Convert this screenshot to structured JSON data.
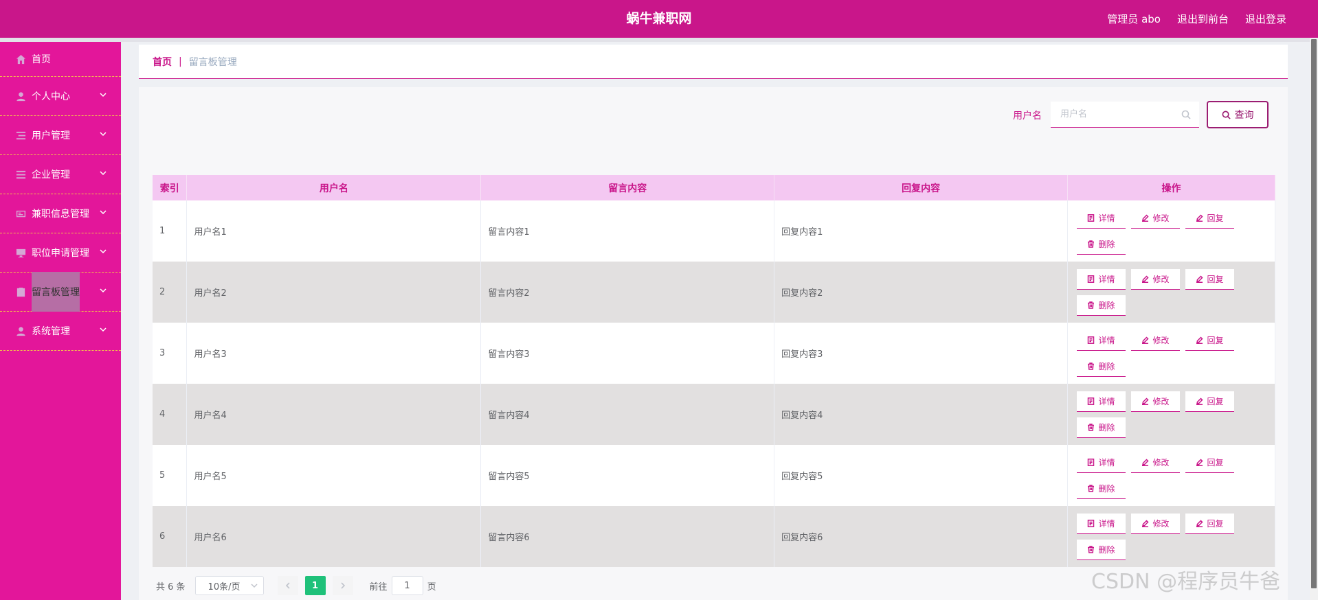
{
  "header": {
    "title": "蜗牛兼职网",
    "admin_label": "管理员 abo",
    "back_to_front": "退出到前台",
    "logout": "退出登录"
  },
  "sidebar": {
    "items": [
      {
        "label": "首页",
        "icon": "home-icon"
      },
      {
        "label": "个人中心",
        "icon": "user-icon"
      },
      {
        "label": "用户管理",
        "icon": "list-icon"
      },
      {
        "label": "企业管理",
        "icon": "menu-icon"
      },
      {
        "label": "兼职信息管理",
        "icon": "card-icon"
      },
      {
        "label": "职位申请管理",
        "icon": "monitor-icon"
      },
      {
        "label": "留言板管理",
        "icon": "clipboard-icon"
      },
      {
        "label": "系统管理",
        "icon": "user-icon"
      }
    ]
  },
  "breadcrumb": {
    "home": "首页",
    "separator": "|",
    "current": "留言板管理"
  },
  "search": {
    "label": "用户名",
    "placeholder": "用户名",
    "button": "查询"
  },
  "table": {
    "headers": [
      "索引",
      "用户名",
      "留言内容",
      "回复内容",
      "操作"
    ],
    "rows": [
      {
        "index": "1",
        "username": "用户名1",
        "message": "留言内容1",
        "reply": "回复内容1"
      },
      {
        "index": "2",
        "username": "用户名2",
        "message": "留言内容2",
        "reply": "回复内容2"
      },
      {
        "index": "3",
        "username": "用户名3",
        "message": "留言内容3",
        "reply": "回复内容3"
      },
      {
        "index": "4",
        "username": "用户名4",
        "message": "留言内容4",
        "reply": "回复内容4"
      },
      {
        "index": "5",
        "username": "用户名5",
        "message": "留言内容5",
        "reply": "回复内容5"
      },
      {
        "index": "6",
        "username": "用户名6",
        "message": "留言内容6",
        "reply": "回复内容6"
      }
    ],
    "actions": {
      "detail": "详情",
      "edit": "修改",
      "reply": "回复",
      "delete": "删除"
    }
  },
  "pagination": {
    "total": "共 6 条",
    "page_size": "10条/页",
    "current_page": "1",
    "goto_label": "前往",
    "goto_value": "1",
    "page_unit": "页"
  },
  "watermark": "CSDN @程序员牛爸",
  "colors": {
    "header": "#c9168a",
    "sidebar": "#e3169a",
    "accent": "#c9168a",
    "table_header": "#f4c8f2",
    "page_active": "#1fc17a"
  }
}
